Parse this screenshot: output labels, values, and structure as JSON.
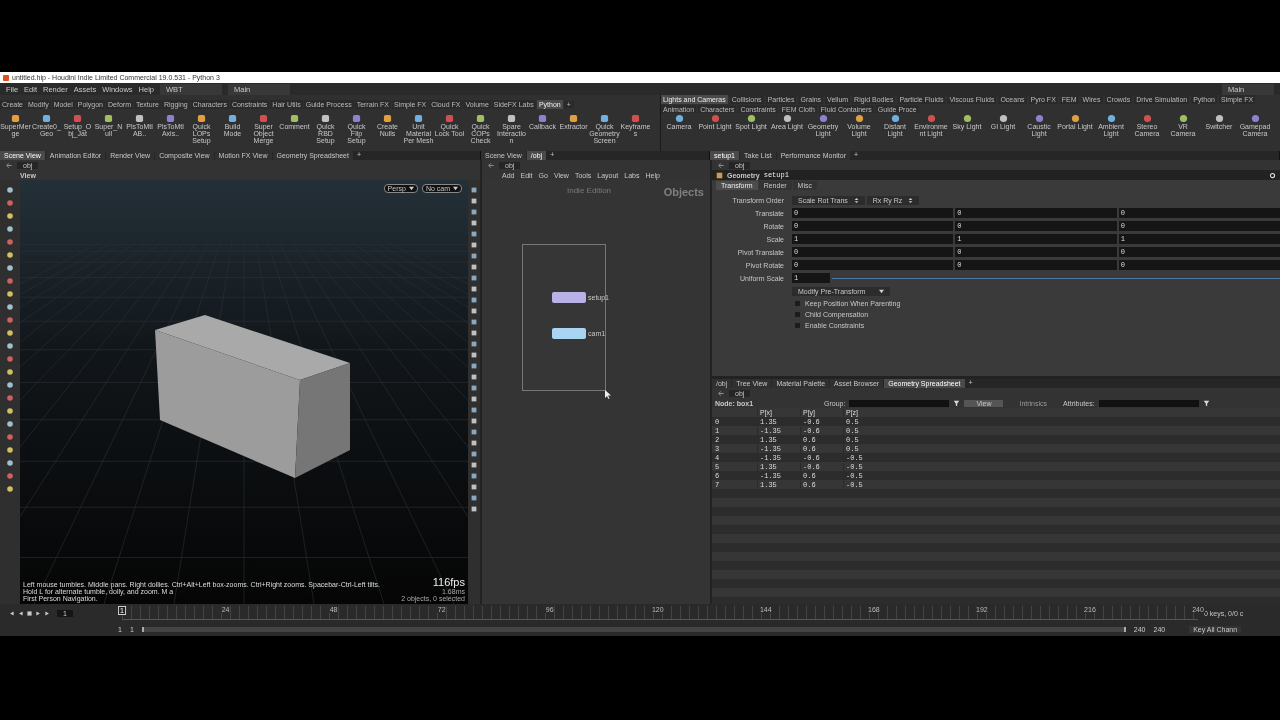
{
  "window": {
    "title": "untitled.hip - Houdini Indie Limited Commercial 19.0.531 - Python 3"
  },
  "menu": {
    "items": [
      "File",
      "Edit",
      "Render",
      "Assets",
      "Windows",
      "Help"
    ],
    "desktop": "WBT",
    "left_desk": "Main",
    "right_desk": "Main"
  },
  "shelf_left": {
    "tabs": [
      {
        "label": "Create",
        "selected": false
      },
      {
        "label": "Modify",
        "selected": false
      },
      {
        "label": "Model",
        "selected": false
      },
      {
        "label": "Polygon",
        "selected": false
      },
      {
        "label": "Deform",
        "selected": false
      },
      {
        "label": "Texture",
        "selected": false
      },
      {
        "label": "Rigging",
        "selected": false
      },
      {
        "label": "Characters",
        "selected": false
      },
      {
        "label": "Constraints",
        "selected": false
      },
      {
        "label": "Hair Utils",
        "selected": false
      },
      {
        "label": "Guide Process",
        "selected": false
      },
      {
        "label": "Terrain FX",
        "selected": false
      },
      {
        "label": "Simple FX",
        "selected": false
      },
      {
        "label": "Cloud FX",
        "selected": false
      },
      {
        "label": "Volume",
        "selected": false
      },
      {
        "label": "SideFX Labs",
        "selected": false
      },
      {
        "label": "Python",
        "selected": true
      }
    ],
    "add": "+",
    "tools": [
      "SuperMerge",
      "Create0_Geo",
      "Setup_Obj_Jat",
      "Super_Null",
      "PlsToMtlAB..",
      "PlsToMtlAxis..",
      "Quick LOPs Setup",
      "Build Mode",
      "Super Object Merge",
      "Comment",
      "Quick RBD Setup",
      "Quick Flip Setup",
      "Create Nulls",
      "Unit Material Per Mesh",
      "Quick Lock Tool",
      "Quick COPs Check",
      "Spare Interaction",
      "Callback",
      "Extractor",
      "Quick Geometry Screen",
      "Keyframes"
    ]
  },
  "shelf_right": {
    "tabs": [
      {
        "label": "Lights and Cameras",
        "selected": true
      },
      {
        "label": "Collisions",
        "selected": false
      },
      {
        "label": "Particles",
        "selected": false
      },
      {
        "label": "Grains",
        "selected": false
      },
      {
        "label": "Vellum",
        "selected": false
      },
      {
        "label": "Rigid Bodies",
        "selected": false
      },
      {
        "label": "Particle Fluids",
        "selected": false
      },
      {
        "label": "Viscous Fluids",
        "selected": false
      },
      {
        "label": "Oceans",
        "selected": false
      },
      {
        "label": "Pyro FX",
        "selected": false
      },
      {
        "label": "FEM",
        "selected": false
      },
      {
        "label": "Wires",
        "selected": false
      },
      {
        "label": "Crowds",
        "selected": false
      },
      {
        "label": "Drive Simulation",
        "selected": false
      },
      {
        "label": "Python",
        "selected": false
      },
      {
        "label": "Simple FX",
        "selected": false
      },
      {
        "label": "Animation",
        "selected": false
      },
      {
        "label": "Characters",
        "selected": false
      },
      {
        "label": "Constraints",
        "selected": false
      },
      {
        "label": "FEM Cloth",
        "selected": false
      },
      {
        "label": "Fluid Containers",
        "selected": false
      },
      {
        "label": "Guide Proce",
        "selected": false
      }
    ],
    "tools": [
      "Camera",
      "Point Light",
      "Spot Light",
      "Area Light",
      "Geometry Light",
      "Volume Light",
      "Distant Light",
      "Environment Light",
      "Sky Light",
      "GI Light",
      "Caustic Light",
      "Portal Light",
      "Ambient Light",
      "Stereo Camera",
      "VR Camera",
      "Switcher",
      "Gamepad Camera"
    ]
  },
  "pane_tabs": {
    "left": {
      "tabs": [
        {
          "label": "Scene View",
          "selected": true
        },
        {
          "label": "Animation Editor",
          "selected": false
        },
        {
          "label": "Render View",
          "selected": false
        },
        {
          "label": "Composite View",
          "selected": false
        },
        {
          "label": "Motion FX View",
          "selected": false
        },
        {
          "label": "Geometry Spreadsheet",
          "selected": false
        }
      ],
      "add": "+"
    },
    "mid": {
      "tabs": [
        {
          "label": "Scene View",
          "selected": false
        },
        {
          "label": "/obj",
          "selected": true
        }
      ],
      "add": "+"
    },
    "right": {
      "tabs": [
        {
          "label": "setup1",
          "selected": true
        },
        {
          "label": "Take List",
          "selected": false
        },
        {
          "label": "Performance Monitor",
          "selected": false
        }
      ],
      "add": "+"
    }
  },
  "viewport": {
    "path": "obj",
    "title": "View",
    "projection": "Persp",
    "camera": "No cam",
    "fps": "116fps",
    "hint": "Left mouse tumbles. Middle pans. Right dollies. Ctrl+Alt+Left box-zooms. Ctrl+Right zooms. Spacebar-Ctrl-Left tilts. Hold L for alternate tumble, dolly, and zoom.",
    "hint_more": "M a",
    "hint_2": "First Person Navigation.",
    "time": "1.68ms",
    "status": "2 objects, 0 selected"
  },
  "network": {
    "path": "obj",
    "menu": [
      "Add",
      "Edit",
      "Go",
      "View",
      "Tools",
      "Layout",
      "Labs",
      "Help"
    ],
    "edition": "Indie Edition",
    "context": "Objects",
    "nodes": [
      {
        "name": "setup1",
        "color": "#b9b2e6"
      },
      {
        "name": "cam1",
        "color": "#a9d4f2"
      }
    ]
  },
  "parameters": {
    "path": "obj",
    "type": "Geometry",
    "name": "setup1",
    "tabs": [
      {
        "label": "Transform",
        "selected": true
      },
      {
        "label": "Render",
        "selected": false
      },
      {
        "label": "Misc",
        "selected": false
      }
    ],
    "order_label": "Transform Order",
    "order": [
      "Scale Rot Trans",
      "Rx Ry Rz"
    ],
    "vectors": [
      {
        "label": "Translate",
        "values": [
          "0",
          "0",
          "0"
        ]
      },
      {
        "label": "Rotate",
        "values": [
          "0",
          "0",
          "0"
        ]
      },
      {
        "label": "Scale",
        "values": [
          "1",
          "1",
          "1"
        ]
      },
      {
        "label": "Pivot Translate",
        "values": [
          "0",
          "0",
          "0"
        ]
      },
      {
        "label": "Pivot Rotate",
        "values": [
          "0",
          "0",
          "0"
        ]
      }
    ],
    "uniform_scale": {
      "label": "Uniform Scale",
      "value": "1"
    },
    "pre_transform": "Modify Pre-Transform",
    "checkboxes": [
      {
        "label": "Keep Position When Parenting",
        "checked": false
      },
      {
        "label": "Child Compensation",
        "checked": false
      },
      {
        "label": "Enable Constraints",
        "checked": false
      }
    ]
  },
  "spreadsheet": {
    "tabs": [
      {
        "label": "/obj",
        "selected": false
      },
      {
        "label": "Tree View",
        "selected": false
      },
      {
        "label": "Material Palette",
        "selected": false
      },
      {
        "label": "Asset Browser",
        "selected": false
      },
      {
        "label": "Geometry Spreadsheet",
        "selected": true
      }
    ],
    "add": "+",
    "path": "obj",
    "node": "Node: box1",
    "group_label": "Group:",
    "view": "View",
    "intrinsics": "Intrinsics",
    "attributes_label": "Attributes:",
    "columns": [
      "",
      "P[x]",
      "P[y]",
      "P[z]"
    ],
    "rows": [
      [
        "0",
        "1.35",
        "-0.6",
        "0.5"
      ],
      [
        "1",
        "-1.35",
        "-0.6",
        "0.5"
      ],
      [
        "2",
        "1.35",
        "0.6",
        "0.5"
      ],
      [
        "3",
        "-1.35",
        "0.6",
        "0.5"
      ],
      [
        "4",
        "-1.35",
        "-0.6",
        "-0.5"
      ],
      [
        "5",
        "1.35",
        "-0.6",
        "-0.5"
      ],
      [
        "6",
        "-1.35",
        "0.6",
        "-0.5"
      ],
      [
        "7",
        "1.35",
        "0.6",
        "-0.5"
      ]
    ]
  },
  "timeline": {
    "frame": "1",
    "ticks": [
      "1",
      "24",
      "48",
      "72",
      "96",
      "120",
      "144",
      "168",
      "192",
      "216",
      "240"
    ],
    "keys": "0 keys, 0/0 c",
    "key_all": "Key All Chann",
    "start": "1",
    "start_2": "1",
    "end": "240",
    "end_2": "240"
  }
}
